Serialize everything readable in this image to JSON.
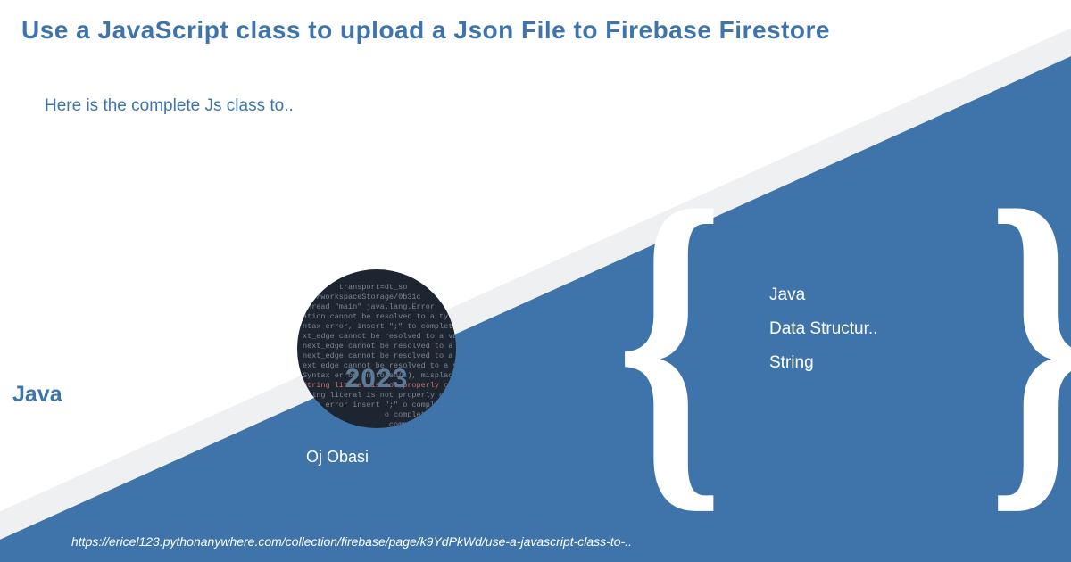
{
  "title": "Use a JavaScript class to upload a Json File to Firebase Firestore",
  "subtitle": "Here is the complete Js class to..",
  "category": "Java",
  "url": "https://ericel123.pythonanywhere.com/collection/firebase/page/k9YdPkWd/use-a-javascript-class-to-..",
  "author": {
    "name": "Oj Obasi",
    "year": "2023"
  },
  "tags": [
    "Java",
    "Data Structur..",
    "String"
  ],
  "braces": {
    "left": "{",
    "right": "}"
  }
}
